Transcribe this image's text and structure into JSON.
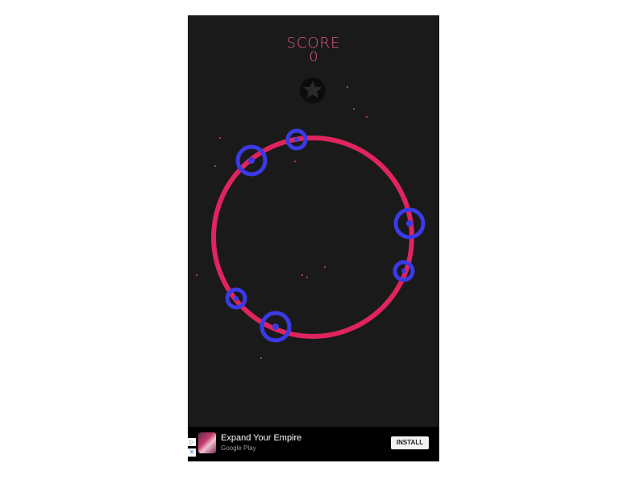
{
  "score": {
    "label": "SCORE",
    "value": "0"
  },
  "colors": {
    "background": "#1b1a1b",
    "ring": "#e0245e",
    "node": "#3a3ae6",
    "text": "#e05a86"
  },
  "icons": {
    "star": "star-icon"
  },
  "ad": {
    "title": "Expand Your Empire",
    "source": "Google Play",
    "button": "INSTALL",
    "adchoices": "▷",
    "close": "✕"
  }
}
